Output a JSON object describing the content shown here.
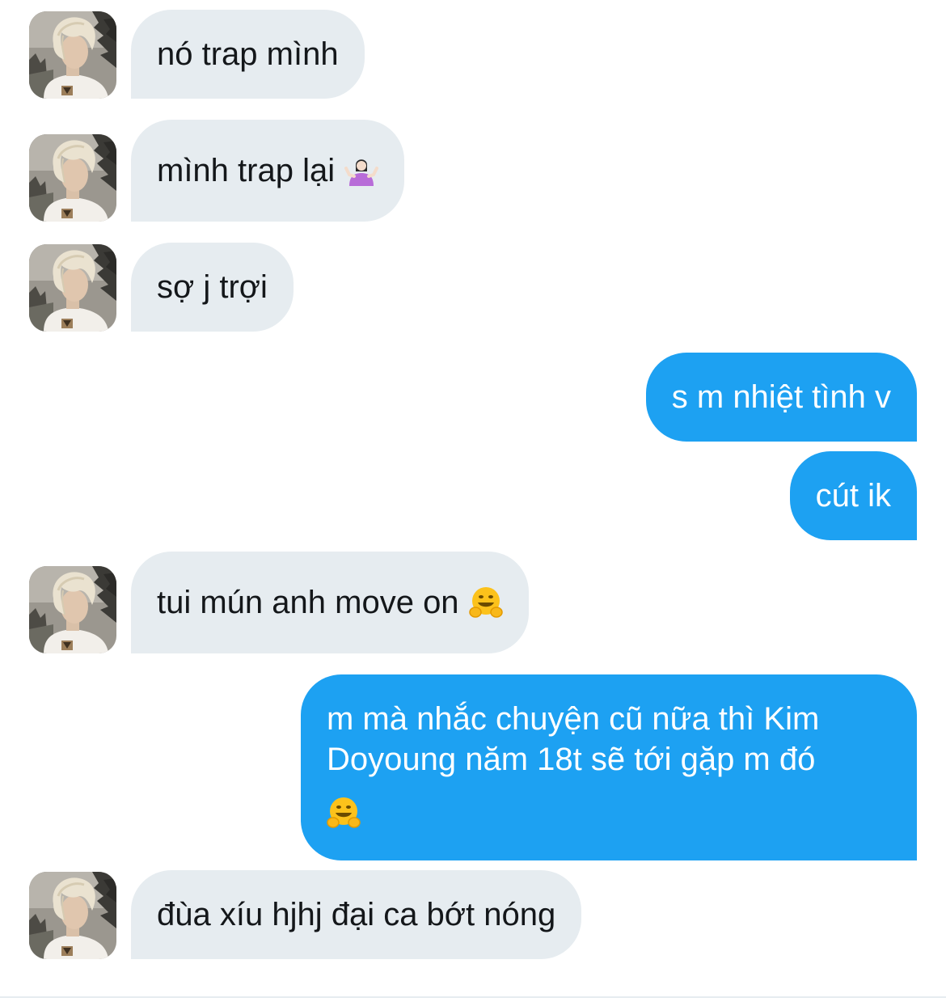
{
  "conversation": {
    "messages": [
      {
        "direction": "incoming",
        "text": "nó trap mình"
      },
      {
        "direction": "incoming",
        "text": "mình trap lại",
        "emoji": "person-shrugging-emoji"
      },
      {
        "direction": "incoming",
        "text": "sợ j trợi"
      },
      {
        "direction": "outgoing",
        "text": "s m nhiệt tình v"
      },
      {
        "direction": "outgoing",
        "text": "cút ik"
      },
      {
        "direction": "incoming",
        "text": "tui mún anh move on",
        "emoji": "hugging-face-emoji"
      },
      {
        "direction": "outgoing",
        "lines": [
          "m mà nhắc chuyện cũ nữa thì Kim",
          "Doyoung năm 18t sẽ tới gặp m đó"
        ],
        "emoji": "hugging-face-emoji"
      },
      {
        "direction": "incoming",
        "text": "đùa xíu hjhj đại ca bớt nóng"
      }
    ]
  },
  "colors": {
    "incoming_bubble": "#e6ecf0",
    "incoming_text": "#14171a",
    "outgoing_bubble": "#1da1f2",
    "outgoing_text": "#ffffff"
  }
}
